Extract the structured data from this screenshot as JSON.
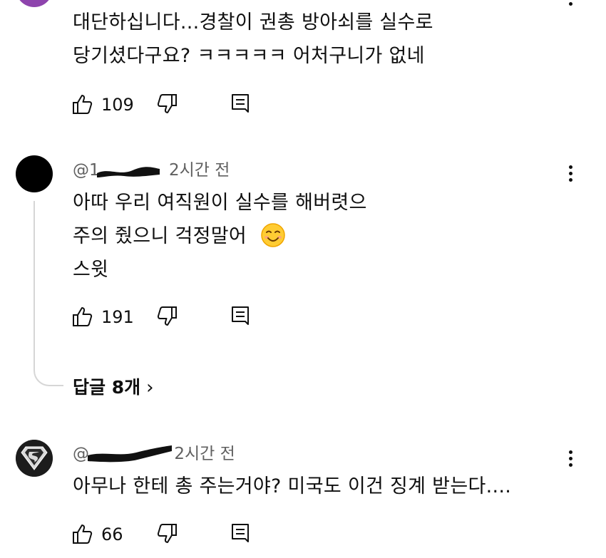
{
  "comments": [
    {
      "avatar": "purple-avatar",
      "lines": [
        "대단하십니다...경찰이 권총 방아쇠를 실수로",
        "당기셨다구요? ㅋㅋㅋㅋㅋ 어처구니가 없네"
      ],
      "likes": "109"
    },
    {
      "avatar": "black-circle-avatar",
      "handle": "@1",
      "time": "2시간 전",
      "lines": [
        "아따 우리 여직원이 실수를 해버렷으",
        "주의 줬으니 걱정말어",
        "스윗"
      ],
      "emoji": "smiling-face",
      "likes": "191",
      "replies_label": "답글 8개",
      "replies_chevron": "›"
    },
    {
      "avatar": "superman-logo-avatar",
      "handle": "@",
      "time": "2시간 전",
      "lines": [
        "아무나 한테 총 주는거야? 미국도 이건 징계 받는다...."
      ],
      "likes": "66"
    }
  ],
  "icons": {
    "like": "thumbs-up-icon",
    "dislike": "thumbs-down-icon",
    "reply": "comment-reply-icon",
    "more": "more-vertical-icon"
  },
  "colors": {
    "text": "#0f0f0f",
    "meta": "#606060",
    "thread_line": "#d6d6d6",
    "purple_avatar": "#8e44ad",
    "redaction": "#111111"
  }
}
